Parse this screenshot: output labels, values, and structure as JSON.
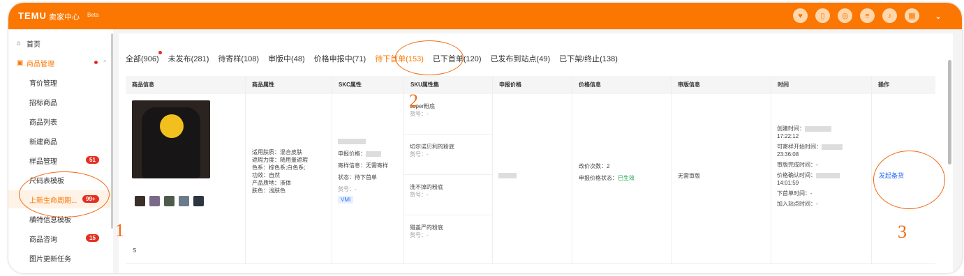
{
  "header": {
    "logo": "TEMU",
    "app": "卖家中心",
    "badge": "Beta"
  },
  "header_icons": [
    "heart-icon",
    "book-icon",
    "chat-icon",
    "document-icon",
    "bell-icon",
    "grid-icon"
  ],
  "sidebar": {
    "items": [
      {
        "label": "首页"
      },
      {
        "label": "商品管理"
      },
      {
        "label": "育价管理"
      },
      {
        "label": "招标商品"
      },
      {
        "label": "商品列表"
      },
      {
        "label": "新建商品"
      },
      {
        "label": "样品管理",
        "badge": "51"
      },
      {
        "label": "尺码表模板"
      },
      {
        "label": "上新生命周期...",
        "badge": "99+"
      },
      {
        "label": "横特信息模板"
      },
      {
        "label": "商品咨询",
        "badge": "15"
      },
      {
        "label": "图片更新任务"
      }
    ]
  },
  "tabs": [
    "全部(906)",
    "未发布(281)",
    "待寄样(108)",
    "审版中(48)",
    "价格申报中(71)",
    "待下首单(153)",
    "已下首单(120)",
    "已发布到站点(49)",
    "已下架/终止(138)"
  ],
  "active_tab": "待下首单(153)",
  "table": {
    "headers": [
      "商品信息",
      "商品属性",
      "SKC属性",
      "SKU属性集",
      "申报价格",
      "价格信息",
      "审版信息",
      "时间",
      "操作"
    ],
    "row": {
      "attrs": [
        "适用肤质：混合皮肤",
        "遮瑕力度：随用量遮瑕",
        "色系：棕色系;白色系;",
        "功效：自然",
        "产品质地：液体",
        "肤色：浅肤色"
      ],
      "skc": {
        "price": "申报价格：",
        "sample": "寄样信息：无需寄样",
        "status": "状态：待下首单",
        "code": "货号：-",
        "vmi": "VMI"
      },
      "skus": [
        {
          "name": "super粉底",
          "code": "货号：-"
        },
        {
          "name": "切尔诺贝利的粉底",
          "code": "货号：-"
        },
        {
          "name": "洗不掉的粉底",
          "code": "货号：-"
        },
        {
          "name": "猎盖严的粉底",
          "code": "货号：-"
        }
      ],
      "price_info": {
        "count": "改价次数：2",
        "status_label": "申报价格状态：",
        "status_value": "已生效"
      },
      "review": "无需审版",
      "times": [
        "创建时间：",
        "17:22:12",
        "可寄样开始时间：",
        "23:36:08",
        "审版完成时间：-",
        "价格确认时间：",
        "14:01:59",
        "下首单时间：-",
        "加入站点时间：-"
      ],
      "action": "发起备货",
      "partial_name": "S"
    }
  },
  "annotations": [
    "1",
    "2",
    "3"
  ],
  "colors": {
    "brand": "#fb7701",
    "annotation": "#f06a12",
    "link": "#2a6ef5",
    "badge": "#e52e21"
  }
}
